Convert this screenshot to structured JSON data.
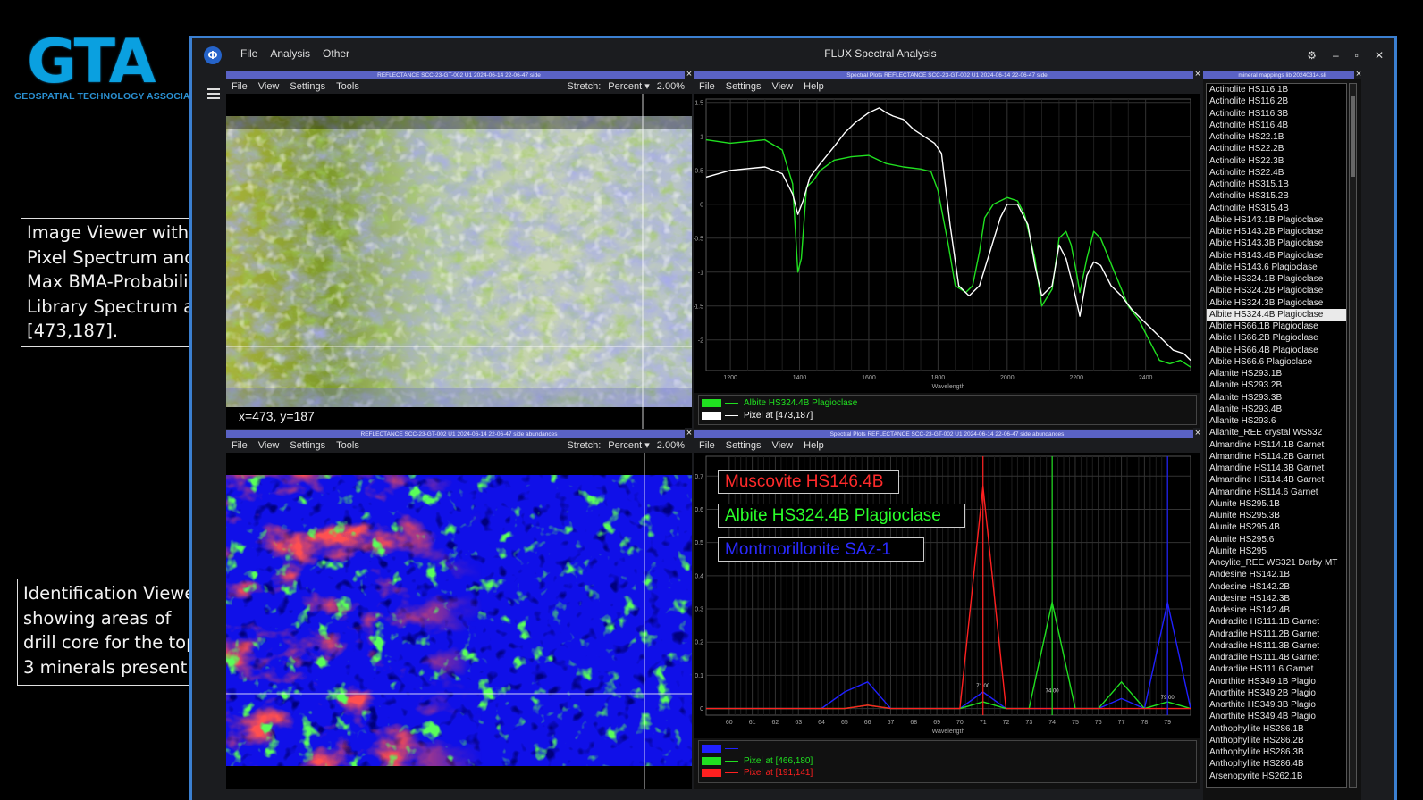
{
  "logo": {
    "letters": "GTA",
    "subtitle": "GEOSPATIAL TECHNOLOGY ASSOCIATES"
  },
  "callouts": {
    "image_viewer": [
      "Image Viewer with",
      "Pixel Spectrum and",
      "Max BMA-Probability",
      "Library Spectrum at",
      "[473,187]."
    ],
    "identification_viewer": [
      "Identification Viewer",
      "showing areas of",
      "drill core for the top",
      "3 minerals present."
    ]
  },
  "window": {
    "title": "FLUX Spectral Analysis",
    "menu": [
      "File",
      "Analysis",
      "Other"
    ],
    "controls": {
      "settings": "⚙",
      "minimize": "–",
      "maximize": "▫",
      "close": "✕"
    }
  },
  "panels": {
    "image_viewer": {
      "title": "REFLECTANCE  SCC-23-GT-002  U1  2024-06-14  22-06-47  side",
      "menu": [
        "File",
        "View",
        "Settings",
        "Tools"
      ],
      "stretch_label": "Stretch:",
      "stretch_mode": "Percent",
      "stretch_value": "2.00%",
      "coords": "x=473, y=187"
    },
    "spectral_plot_top": {
      "title": "Spectral Plots  REFLECTANCE  SCC-23-GT-002  U1  2024-06-14  22-06-47  side",
      "menu": [
        "File",
        "Settings",
        "View",
        "Help"
      ]
    },
    "abundance_viewer": {
      "title": "REFLECTANCE  SCC-23-GT-002  U1  2024-06-14  22-06-47  side  abundances",
      "menu": [
        "File",
        "View",
        "Settings",
        "Tools"
      ],
      "stretch_label": "Stretch:",
      "stretch_mode": "Percent",
      "stretch_value": "2.00%"
    },
    "spectral_plot_bottom": {
      "title": "Spectral Plots  REFLECTANCE  SCC-23-GT-002  U1  2024-06-14  22-06-47  side  abundances",
      "menu": [
        "File",
        "Settings",
        "View",
        "Help"
      ]
    },
    "mineral_list": {
      "title": "mineral  mappings  lib  20240314.sli",
      "selected_index": 19,
      "items": [
        "Actinolite HS116.1B",
        "Actinolite HS116.2B",
        "Actinolite HS116.3B",
        "Actinolite HS116.4B",
        "Actinolite HS22.1B",
        "Actinolite HS22.2B",
        "Actinolite HS22.3B",
        "Actinolite HS22.4B",
        "Actinolite HS315.1B",
        "Actinolite HS315.2B",
        "Actinolite HS315.4B",
        "Albite HS143.1B Plagioclase",
        "Albite HS143.2B Plagioclase",
        "Albite HS143.3B Plagioclase",
        "Albite HS143.4B Plagioclase",
        "Albite HS143.6  Plagioclase",
        "Albite HS324.1B Plagioclase",
        "Albite HS324.2B Plagioclase",
        "Albite HS324.3B Plagioclase",
        "Albite HS324.4B Plagioclase",
        "Albite HS66.1B Plagioclase",
        "Albite HS66.2B Plagioclase",
        "Albite HS66.4B Plagioclase",
        "Albite HS66.6  Plagioclase",
        "Allanite HS293.1B",
        "Allanite HS293.2B",
        "Allanite HS293.3B",
        "Allanite HS293.4B",
        "Allanite HS293.6",
        "Allanite_REE crystal WS532",
        "Almandine HS114.1B Garnet",
        "Almandine HS114.2B Garnet",
        "Almandine HS114.3B Garnet",
        "Almandine HS114.4B Garnet",
        "Almandine HS114.6  Garnet",
        "Alunite HS295.1B",
        "Alunite HS295.3B",
        "Alunite HS295.4B",
        "Alunite HS295.6",
        "Alunite HS295",
        "Ancylite_REE WS321 Darby MT",
        "Andesine HS142.1B",
        "Andesine HS142.2B",
        "Andesine HS142.3B",
        "Andesine HS142.4B",
        "Andradite HS111.1B Garnet",
        "Andradite HS111.2B Garnet",
        "Andradite HS111.3B Garnet",
        "Andradite HS111.4B Garnet",
        "Andradite HS111.6  Garnet",
        "Anorthite HS349.1B Plagio",
        "Anorthite HS349.2B Plagio",
        "Anorthite HS349.3B Plagio",
        "Anorthite HS349.4B Plagio",
        "Anthophyllite HS286.1B",
        "Anthophyllite HS286.2B",
        "Anthophyllite HS286.3B",
        "Anthophyllite HS286.4B",
        "Arsenopyrite HS262.1B"
      ]
    }
  },
  "mineral_labels": [
    {
      "text": "Muscovite HS146.4B",
      "color": "#ff2a2a"
    },
    {
      "text": "Albite HS324.4B Plagioclase",
      "color": "#2aff2a"
    },
    {
      "text": "Montmorillonite SAz-1",
      "color": "#2a2aff"
    }
  ],
  "colors": {
    "accent": "#3b7fd0",
    "panel_title": "#5a62c4",
    "red": "#ff2020",
    "green": "#20e020",
    "blue": "#2020ff",
    "white": "#ffffff"
  },
  "chart_data": [
    {
      "type": "line",
      "xlabel": "Wavelength",
      "ylabel": "",
      "xlim": [
        1130,
        2530
      ],
      "ylim": [
        -2.45,
        1.55
      ],
      "x_ticks": [
        1200,
        1400,
        1600,
        1800,
        2000,
        2200,
        2400
      ],
      "y_ticks": [
        1.5,
        1,
        0.5,
        0,
        -0.5,
        -1,
        -1.5,
        -2
      ],
      "y_tick_labels": [
        "1.5",
        "1",
        "0.5",
        "0",
        "-0.5",
        "-1",
        "-1.5",
        "-2"
      ],
      "grid": true,
      "series": [
        {
          "name": "Albite HS324.4B Plagioclase",
          "color": "#20e020",
          "x": [
            1130,
            1200,
            1300,
            1350,
            1380,
            1395,
            1405,
            1420,
            1440,
            1460,
            1500,
            1550,
            1600,
            1650,
            1700,
            1750,
            1780,
            1800,
            1830,
            1850,
            1880,
            1900,
            1920,
            1935,
            1960,
            2000,
            2030,
            2050,
            2080,
            2100,
            2130,
            2150,
            2170,
            2185,
            2200,
            2210,
            2230,
            2250,
            2270,
            2290,
            2310,
            2330,
            2350,
            2380,
            2410,
            2440,
            2470,
            2500,
            2530
          ],
          "y": [
            0.95,
            0.9,
            0.95,
            0.8,
            0.3,
            -1.0,
            -0.8,
            0.25,
            0.35,
            0.5,
            0.65,
            0.7,
            0.72,
            0.6,
            0.55,
            0.52,
            0.48,
            0.2,
            -0.6,
            -1.2,
            -1.3,
            -1.2,
            -0.7,
            -0.2,
            0.0,
            0.1,
            0.05,
            -0.15,
            -0.8,
            -1.5,
            -1.25,
            -0.5,
            -0.4,
            -0.6,
            -1.0,
            -1.3,
            -0.8,
            -0.4,
            -0.5,
            -0.75,
            -1.0,
            -1.25,
            -1.5,
            -1.7,
            -2.0,
            -2.3,
            -2.35,
            -2.3,
            -2.4
          ]
        },
        {
          "name": "Pixel at [473,187]",
          "color": "#ffffff",
          "x": [
            1130,
            1200,
            1300,
            1350,
            1380,
            1395,
            1410,
            1430,
            1460,
            1500,
            1530,
            1560,
            1600,
            1630,
            1650,
            1670,
            1700,
            1730,
            1760,
            1790,
            1810,
            1835,
            1860,
            1890,
            1920,
            1950,
            1980,
            2000,
            2030,
            2060,
            2080,
            2100,
            2130,
            2150,
            2170,
            2190,
            2210,
            2230,
            2250,
            2270,
            2300,
            2330,
            2360,
            2390,
            2420,
            2450,
            2480,
            2510,
            2530
          ],
          "y": [
            0.4,
            0.5,
            0.55,
            0.45,
            0.15,
            -0.15,
            0.05,
            0.4,
            0.6,
            0.85,
            1.05,
            1.2,
            1.35,
            1.42,
            1.35,
            1.3,
            1.25,
            1.1,
            1.0,
            0.9,
            0.75,
            -0.3,
            -1.2,
            -1.35,
            -1.2,
            -0.7,
            -0.2,
            0.0,
            0.0,
            -0.3,
            -0.9,
            -1.35,
            -1.2,
            -0.6,
            -0.8,
            -1.2,
            -1.65,
            -1.05,
            -0.85,
            -0.9,
            -1.2,
            -1.35,
            -1.55,
            -1.7,
            -1.85,
            -2.0,
            -2.15,
            -2.2,
            -2.3
          ]
        }
      ]
    },
    {
      "type": "line",
      "xlabel": "Wavelength",
      "ylabel": "",
      "xlim": [
        59,
        80
      ],
      "ylim": [
        -0.02,
        0.76
      ],
      "x_ticks": [
        60,
        61,
        62,
        63,
        64,
        65,
        66,
        67,
        68,
        69,
        70,
        71,
        72,
        73,
        74,
        75,
        76,
        77,
        78,
        79
      ],
      "y_ticks": [
        0,
        0.1,
        0.2,
        0.3,
        0.4,
        0.5,
        0.6,
        0.7
      ],
      "y_tick_labels": [
        "0",
        "0.1",
        "0.2",
        "0.3",
        "0.4",
        "0.5",
        "0.6",
        "0.7"
      ],
      "grid": true,
      "annotations": [
        {
          "x": 71.0,
          "y": 0.055,
          "text": "71.00"
        },
        {
          "x": 74.0,
          "y": 0.04,
          "text": "74.00"
        },
        {
          "x": 79.0,
          "y": 0.02,
          "text": "79.00"
        }
      ],
      "series": [
        {
          "name": "",
          "color": "#2020ff",
          "x": [
            59,
            64,
            65,
            66,
            67,
            70,
            71,
            72,
            73,
            74,
            75,
            76,
            77,
            78,
            79,
            80
          ],
          "y": [
            0,
            0,
            0.05,
            0.08,
            0,
            0,
            0.05,
            0,
            0,
            0,
            0,
            0,
            0.03,
            0,
            0.32,
            0
          ]
        },
        {
          "name": "Pixel at [466,180]",
          "color": "#20e020",
          "x": [
            59,
            65,
            66,
            67,
            70,
            71,
            72,
            73,
            74,
            75,
            76,
            77,
            78,
            79,
            80
          ],
          "y": [
            0,
            0,
            0.01,
            0,
            0,
            0.02,
            0,
            0,
            0.32,
            0,
            0,
            0.08,
            0,
            0.02,
            0
          ]
        },
        {
          "name": "Pixel at [191,141]",
          "color": "#ff2020",
          "x": [
            59,
            65,
            66,
            67,
            70,
            71,
            72,
            73,
            74,
            75,
            76,
            77,
            78,
            79,
            80
          ],
          "y": [
            0,
            0,
            0.01,
            0,
            0,
            0.67,
            0,
            0,
            0,
            0,
            0,
            0,
            0,
            0,
            0
          ]
        }
      ]
    }
  ],
  "legends": {
    "top": [
      {
        "label": "Albite HS324.4B Plagioclase",
        "color": "#20e020"
      },
      {
        "label": "Pixel at [473,187]",
        "color": "#ffffff"
      }
    ],
    "bottom": [
      {
        "label": "",
        "color": "#2020ff"
      },
      {
        "label": "Pixel at [466,180]",
        "color": "#20e020"
      },
      {
        "label": "Pixel at [191,141]",
        "color": "#ff2020"
      }
    ]
  }
}
